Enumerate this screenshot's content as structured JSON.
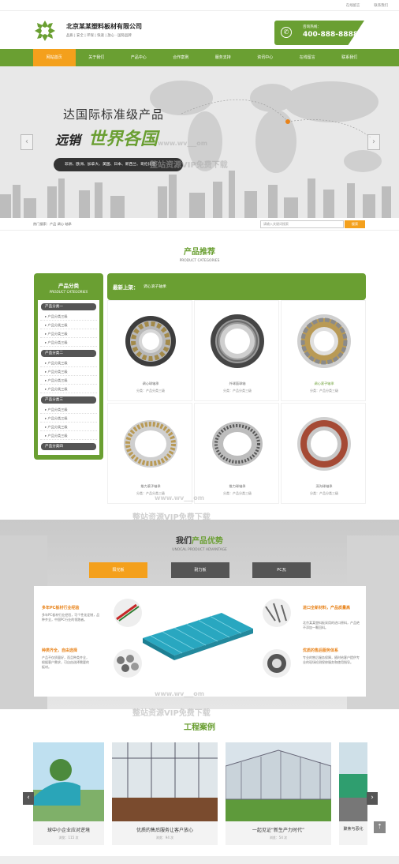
{
  "top_links": [
    "在线留言",
    "联系我们"
  ],
  "company": {
    "name": "北京某某塑料板材有限公司",
    "slogan": "品质 | 安全 | 环保 | 快速 | 放心 · 国际品牌"
  },
  "hotline": {
    "label": "咨询热线：",
    "number": "400-888-8888"
  },
  "nav": [
    "网站首页",
    "关于我们",
    "产品中心",
    "合作案例",
    "服务支持",
    "资讯中心",
    "在线留言",
    "联系我们"
  ],
  "nav_active": 0,
  "banner": {
    "title": "达国际标准级产品",
    "sub_dark": "远销",
    "sub_green": "世界各国",
    "countries": "非洲、欧洲、加拿大、美国、日本、新西兰、哥伦比亚",
    "prev": "‹",
    "next": "›"
  },
  "watermark": {
    "url": "www.wv___om",
    "text": "整站资源VIP免费下载"
  },
  "search": {
    "hot": "热门搜索：产品  调心  轴承",
    "placeholder": "请输入关键词搜索",
    "button": "搜索"
  },
  "products_section": {
    "title": "产品推荐",
    "subtitle": "PRODUCT CATEGORIES"
  },
  "sidebar": {
    "title": "产品分类",
    "subtitle": "PRODUCT CATEGORIES",
    "groups": [
      {
        "name": "产品分类一",
        "items": [
          "产品分类三级",
          "产品分类三级",
          "产品分类三级",
          "产品分类三级"
        ]
      },
      {
        "name": "产品分类二",
        "items": [
          "产品分类三级",
          "产品分类三级",
          "产品分类三级",
          "产品分类三级"
        ]
      },
      {
        "name": "产品分类三",
        "items": [
          "产品分类三级",
          "产品分类三级",
          "产品分类三级",
          "产品分类三级"
        ]
      },
      {
        "name": "产品分类四",
        "items": []
      }
    ]
  },
  "new_bar": {
    "title": "最新上架：",
    "keyword": "调心滚子轴承"
  },
  "products": [
    {
      "name": "调心球轴承",
      "category": "分类：产品分类三级"
    },
    {
      "name": "外球面球轴",
      "category": "分类：产品分类三级"
    },
    {
      "name": "调心滚子轴承",
      "category": "分类：产品分类三级"
    },
    {
      "name": "推力滚子轴承",
      "category": "分类：产品分类三级"
    },
    {
      "name": "推力球轴承",
      "category": "分类：产品分类三级"
    },
    {
      "name": "深沟球轴承",
      "category": "分类：产品分类三级"
    }
  ],
  "advantage": {
    "title_dark": "我们",
    "title_green": "产品优势",
    "subtitle": "UNOCAL PRODUCT ADVANTAGE",
    "tabs": [
      "阳光板",
      "耐力板",
      "PC瓦"
    ],
    "items": [
      {
        "title": "多年PC板材行业经验",
        "desc": "多年PC板材行业经验，可个性化定制，品种齐全，中国PC行业的领跑者。"
      },
      {
        "title": "种类齐全，自由选择",
        "desc": "产品不仅质量好，而且种类齐全，根据客户需求，可自由选择需要的板材。"
      },
      {
        "title": "进口全新材料，产品质量高",
        "desc": "北京某某塑料板采用的进口原料，产品绝不添加一颗回料。"
      },
      {
        "title": "优质的售后服务体系",
        "desc": "专业的售后服务保障，随时给客户提供专业的现场检测保修服务和使用指导。"
      }
    ]
  },
  "cases_section": {
    "title": "工程案例"
  },
  "cases": [
    {
      "title": "球中小企业应对逆境",
      "hits": "浏览：115 次"
    },
    {
      "title": "优质的售后服务让客户放心",
      "hits": "浏览：94 次"
    },
    {
      "title": "一起见证“新生产力时代”",
      "hits": "浏览：54 次"
    },
    {
      "title": "聚焦与恶化",
      "hits": ""
    }
  ],
  "arrows": {
    "left": "‹",
    "right": "›",
    "top": "⇡"
  },
  "colors": {
    "green": "#6a9f32",
    "orange": "#f4a01c",
    "dark": "#333333"
  }
}
